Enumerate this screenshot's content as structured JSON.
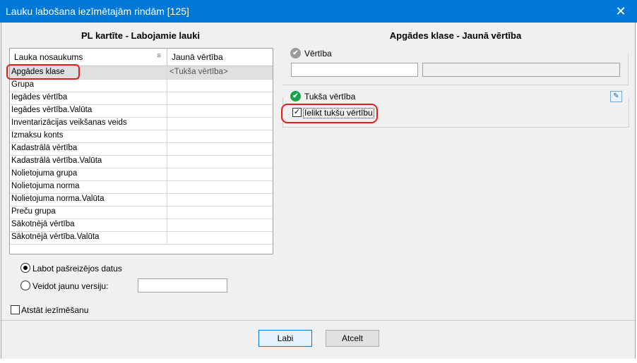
{
  "window": {
    "title": "Lauku labošana iezīmētajām rindām [125]",
    "close_glyph": "✕"
  },
  "left_panel": {
    "title": "PL kartīte - Labojamie lauki",
    "columns": [
      "Lauka nosaukums",
      "Jaunā vērtība"
    ],
    "rows": [
      {
        "name": "Apgādes klase",
        "value": "<Tukša vērtība>"
      },
      {
        "name": "Grupa",
        "value": ""
      },
      {
        "name": "Iegādes vērtība",
        "value": ""
      },
      {
        "name": "Iegādes vērtība.Valūta",
        "value": ""
      },
      {
        "name": "Inventarizācijas veikšanas veids",
        "value": ""
      },
      {
        "name": "Izmaksu konts",
        "value": ""
      },
      {
        "name": "Kadastrālā vērtība",
        "value": ""
      },
      {
        "name": "Kadastrālā vērtība.Valūta",
        "value": ""
      },
      {
        "name": "Nolietojuma grupa",
        "value": ""
      },
      {
        "name": "Nolietojuma norma",
        "value": ""
      },
      {
        "name": "Nolietojuma norma.Valūta",
        "value": ""
      },
      {
        "name": "Preču grupa",
        "value": ""
      },
      {
        "name": "Sākotnējā vērtība",
        "value": ""
      },
      {
        "name": "Sākotnējā vērtība.Valūta",
        "value": ""
      }
    ],
    "selected_row": 0
  },
  "options": {
    "radio_edit_label": "Labot pašreizējos datus",
    "radio_new_label": "Veidot jaunu versiju:",
    "radio_selected": "edit",
    "new_version_value": "",
    "keep_selection_label": "Atstāt iezīmēšanu",
    "keep_selection_checked": false
  },
  "right_panel": {
    "title": "Apgādes klase - Jaunā vērtība",
    "value_group_label": "Vērtība",
    "value_code": "",
    "value_description": "",
    "empty_group_label": "Tukša vērtība",
    "empty_checkbox_label": "Ielikt tukšu vērtību",
    "empty_checkbox_checked": true
  },
  "buttons": {
    "ok_label": "Labi",
    "cancel_label": "Atcelt"
  },
  "colors": {
    "titlebar": "#0078d7",
    "highlight": "#e02020",
    "check_green": "#1aa34a",
    "check_grey": "#9a9a9a"
  }
}
